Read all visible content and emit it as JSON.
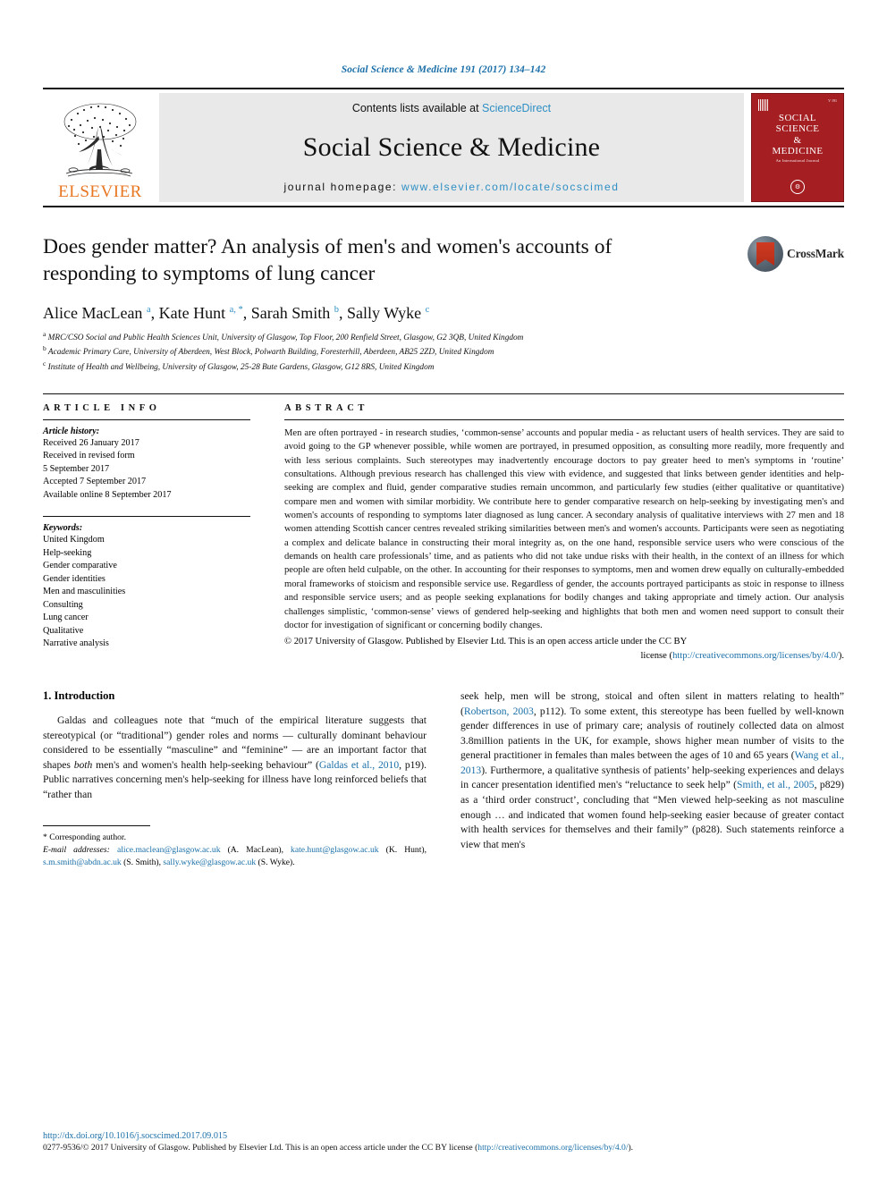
{
  "running_head": "Social Science & Medicine 191 (2017) 134–142",
  "masthead": {
    "publisher_name": "ELSEVIER",
    "contents_prefix": "Contents lists available at ",
    "sciencedirect": "ScienceDirect",
    "journal_name": "Social Science & Medicine",
    "homepage_prefix": "journal homepage: ",
    "homepage_url": "www.elsevier.com/locate/socscimed",
    "cover": {
      "title_line_1": "SOCIAL",
      "title_line_2": "SCIENCE",
      "title_line_3": "&",
      "title_line_4": "MEDICINE",
      "subtitle": "An International Journal",
      "issue_label": "ISSN",
      "volume_label": "V 191",
      "seal_glyph": "⚙"
    }
  },
  "title": "Does gender matter? An analysis of men's and women's accounts of responding to symptoms of lung cancer",
  "crossmark_label": "CrossMark",
  "authors_html": "Alice MacLean <sup>a</sup>, Kate Hunt <sup>a, *</sup>, Sarah Smith <sup>b</sup>, Sally Wyke <sup>c</sup>",
  "affiliations": [
    {
      "mark": "a",
      "text": "MRC/CSO Social and Public Health Sciences Unit, University of Glasgow, Top Floor, 200 Renfield Street, Glasgow, G2 3QB, United Kingdom"
    },
    {
      "mark": "b",
      "text": "Academic Primary Care, University of Aberdeen, West Block, Polwarth Building, Foresterhill, Aberdeen, AB25 2ZD, United Kingdom"
    },
    {
      "mark": "c",
      "text": "Institute of Health and Wellbeing, University of Glasgow, 25-28 Bute Gardens, Glasgow, G12 8RS, United Kingdom"
    }
  ],
  "article_info": {
    "heading": "ARTICLE INFO",
    "history_label": "Article history:",
    "history": [
      "Received 26 January 2017",
      "Received in revised form",
      "5 September 2017",
      "Accepted 7 September 2017",
      "Available online 8 September 2017"
    ],
    "keywords_label": "Keywords:",
    "keywords": [
      "United Kingdom",
      "Help-seeking",
      "Gender comparative",
      "Gender identities",
      "Men and masculinities",
      "Consulting",
      "Lung cancer",
      "Qualitative",
      "Narrative analysis"
    ]
  },
  "abstract": {
    "heading": "ABSTRACT",
    "text": "Men are often portrayed - in research studies, ‘common-sense’ accounts and popular media - as reluctant users of health services. They are said to avoid going to the GP whenever possible, while women are portrayed, in presumed opposition, as consulting more readily, more frequently and with less serious complaints. Such stereotypes may inadvertently encourage doctors to pay greater heed to men's symptoms in ‘routine’ consultations. Although previous research has challenged this view with evidence, and suggested that links between gender identities and help-seeking are complex and fluid, gender comparative studies remain uncommon, and particularly few studies (either qualitative or quantitative) compare men and women with similar morbidity. We contribute here to gender comparative research on help-seeking by investigating men's and women's accounts of responding to symptoms later diagnosed as lung cancer. A secondary analysis of qualitative interviews with 27 men and 18 women attending Scottish cancer centres revealed striking similarities between men's and women's accounts. Participants were seen as negotiating a complex and delicate balance in constructing their moral integrity as, on the one hand, responsible service users who were conscious of the demands on health care professionals’ time, and as patients who did not take undue risks with their health, in the context of an illness for which people are often held culpable, on the other. In accounting for their responses to symptoms, men and women drew equally on culturally-embedded moral frameworks of stoicism and responsible service use. Regardless of gender, the accounts portrayed participants as stoic in response to illness and responsible service users; and as people seeking explanations for bodily changes and taking appropriate and timely action. Our analysis challenges simplistic, ‘common-sense’ views of gendered help-seeking and highlights that both men and women need support to consult their doctor for investigation of significant or concerning bodily changes.",
    "copyright": "© 2017 University of Glasgow. Published by Elsevier Ltd. This is an open access article under the CC BY",
    "license_prefix": "license (",
    "license_url": "http://creativecommons.org/licenses/by/4.0/",
    "license_suffix": ")."
  },
  "body": {
    "section_title": "1. Introduction",
    "left_paragraph_parts": {
      "p1_a": "Galdas and colleagues note that “much of the empirical literature suggests that stereotypical (or “traditional”) gender roles and norms — culturally dominant behaviour considered to be essentially “masculine” and “feminine” — are an important factor that shapes ",
      "p1_italic": "both",
      "p1_b": " men's and women's health help-seeking behaviour” (",
      "p1_cite": "Galdas et al., 2010",
      "p1_c": ", p19). Public narratives concerning men's help-seeking for illness have long reinforced beliefs that “rather than"
    },
    "right_paragraph_parts": {
      "a": "seek help, men will be strong, stoical and often silent in matters relating to health” (",
      "cite1": "Robertson, 2003",
      "b": ", p112). To some extent, this stereotype has been fuelled by well-known gender differences in use of primary care; analysis of routinely collected data on almost 3.8million patients in the UK, for example, shows higher mean number of visits to the general practitioner in females than males between the ages of 10 and 65 years (",
      "cite2": "Wang et al., 2013",
      "c": "). Furthermore, a qualitative synthesis of patients’ help-seeking experiences and delays in cancer presentation identified men's “reluctance to seek help” (",
      "cite3": "Smith, et al., 2005",
      "d": ", p829) as a ‘third order construct’, concluding that “Men viewed help-seeking as not masculine enough … and indicated that women found help-seeking easier because of greater contact with health services for themselves and their family” (p828). Such statements reinforce a view that men's"
    }
  },
  "footnote": {
    "corresponding": "* Corresponding author.",
    "email_label": "E-mail addresses:",
    "emails": [
      {
        "address": "alice.maclean@glasgow.ac.uk",
        "person": " (A. MacLean), "
      },
      {
        "address": "kate.hunt@glasgow.ac.uk",
        "person": " (K. Hunt), "
      },
      {
        "address": "s.m.smith@abdn.ac.uk",
        "person": " (S. Smith), "
      },
      {
        "address": "sally.wyke@glasgow.ac.uk",
        "person": " (S. Wyke)."
      }
    ]
  },
  "bottom": {
    "doi": "http://dx.doi.org/10.1016/j.socscimed.2017.09.015",
    "issn_copyright": "0277-9536/© 2017 University of Glasgow. Published by Elsevier Ltd. This is an open access article under the CC BY license (",
    "issn_license_url": "http://creativecommons.org/licenses/by/4.0/",
    "issn_suffix": ")."
  },
  "colors": {
    "link": "#1a6fa8",
    "elsevier_orange": "#E87722",
    "cover_red": "#A41E22",
    "banner_gray": "#e9e9e9"
  }
}
